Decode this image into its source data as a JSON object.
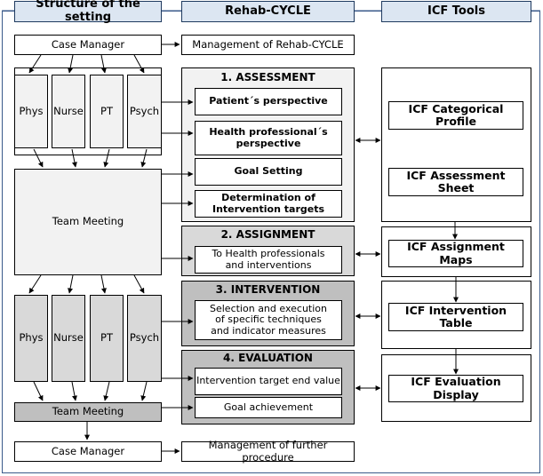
{
  "headers": {
    "structure": "Structure of the setting",
    "cycle": "Rehab-CYCLE",
    "tools": "ICF Tools"
  },
  "structure": {
    "case_manager": "Case Manager",
    "staff": [
      "Phys",
      "Nurse",
      "PT",
      "Psych"
    ],
    "team_meeting": "Team Meeting",
    "staff_2": [
      "Phys",
      "Nurse",
      "PT",
      "Psych"
    ],
    "team_meeting_2": "Team Meeting",
    "case_manager_2": "Case Manager"
  },
  "cycle": {
    "management": "Management of Rehab-CYCLE",
    "assessment": {
      "title": "1. ASSESSMENT",
      "items": [
        "Patient´s perspective",
        "Health professional´s perspective",
        "Goal Setting",
        "Determination of Intervention targets"
      ]
    },
    "assignment": {
      "title": "2. ASSIGNMENT",
      "items": [
        "To Health professionals and interventions"
      ]
    },
    "intervention": {
      "title": "3. INTERVENTION",
      "items": [
        "Selection and execution of specific techniques and indicator measures"
      ]
    },
    "evaluation": {
      "title": "4. EVALUATION",
      "items": [
        "Intervention target end value",
        "Goal achievement"
      ]
    },
    "further": "Management of further procedure"
  },
  "tools": {
    "categorical_profile": "ICF Categorical Profile",
    "assessment_sheet": "ICF Assessment Sheet",
    "assignment_maps": "ICF Assignment Maps",
    "intervention_table": "ICF Intervention Table",
    "evaluation_display": "ICF Evaluation Display"
  },
  "colors": {
    "header": "#dce6f2",
    "frame": "#3a5a8a",
    "assignment": "#d9d9d9",
    "intervention": "#bfbfbf",
    "evaluation": "#bfbfbf"
  }
}
